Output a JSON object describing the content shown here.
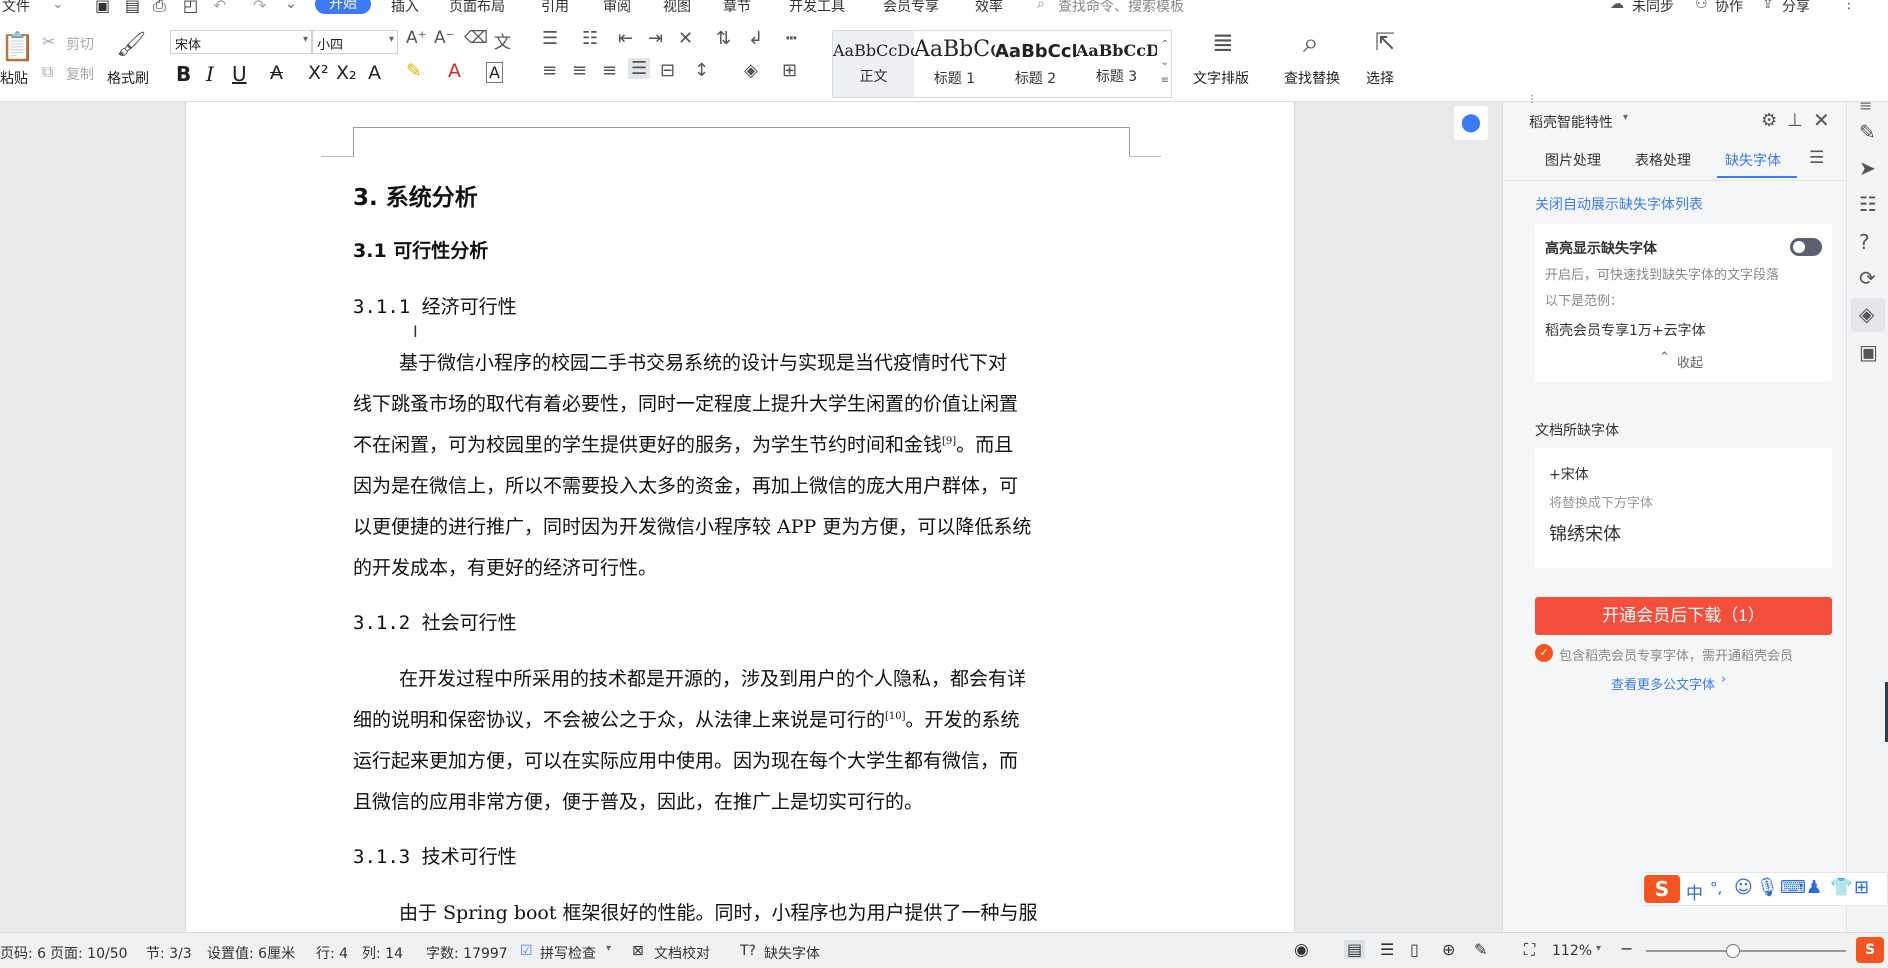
{
  "menu": {
    "file": "文件",
    "home": "开始",
    "insert": "插入",
    "layout": "页面布局",
    "references": "引用",
    "review": "审阅",
    "view": "视图",
    "chapter": "章节",
    "devtools": "开发工具",
    "member": "会员专享",
    "efficiency": "效率",
    "search_placeholder": "查找命令、搜索模板",
    "sync": "未同步",
    "collab": "协作",
    "share": "分享"
  },
  "ribbon": {
    "cut": "剪切",
    "copy": "复制",
    "paste": "粘贴",
    "format_painter": "格式刷",
    "font_name": "宋体",
    "font_size": "小四",
    "styles": [
      {
        "preview": "AaBbCcDd",
        "label": "正文"
      },
      {
        "preview": "AaBbCc",
        "label": "标题 1"
      },
      {
        "preview": "AaBbCcI",
        "label": "标题 2"
      },
      {
        "preview": "AaBbCcDd",
        "label": "标题 3"
      }
    ],
    "text_layout": "文字排版",
    "find_replace": "查找替换",
    "select": "选择"
  },
  "doc": {
    "h_sys": "3. 系统分析",
    "h_feas": "3.1 可行性分析",
    "h_econ": "3.1.1 经济可行性",
    "econ_lines": [
      "基于微信小程序的校园二手书交易系统的设计与实现是当代疫情时代下对",
      "线下跳蚤市场的取代有着必要性，同时一定程度上提升大学生闲置的价值让闲置",
      "不在闲置，可为校园里的学生提供更好的服务，为学生节约时间和金钱",
      "。而且",
      "因为是在微信上，所以不需要投入太多的资金，再加上微信的庞大用户群体，可",
      "以更便捷的进行推广，同时因为开发微信小程序较 APP 更为方便，可以降低系统",
      "的开发成本，有更好的经济可行性。"
    ],
    "cite9": "[9]",
    "h_soc": "3.1.2 社会可行性",
    "soc_lines": [
      "在开发过程中所采用的技术都是开源的，涉及到用户的个人隐私，都会有详",
      "细的说明和保密协议，不会被公之于众，从法律上来说是可行的",
      "。开发的系统",
      "运行起来更加方便，可以在实际应用中使用。因为现在每个大学生都有微信，而",
      "且微信的应用非常方便，便于普及，因此，在推广上是切实可行的。"
    ],
    "cite10": "[10]",
    "h_tech": "3.1.3 技术可行性",
    "tech_line": "由于 Spring boot 框架很好的性能。同时，小程序也为用户提供了一种与服"
  },
  "panel": {
    "title": "稻壳智能特性",
    "tabs": [
      "图片处理",
      "表格处理",
      "缺失字体"
    ],
    "close_auto": "关闭自动展示缺失字体列表",
    "highlight_title": "高亮显示缺失字体",
    "highlight_desc": "开启后，可快速找到缺失字体的文字段落",
    "example_label": "以下是范例：",
    "example_text": "稻壳会员专享1万+云字体",
    "collapse": "收起",
    "missing_title": "文档所缺字体",
    "missing_font": "+宋体",
    "replace_hint": "将替换成下方字体",
    "replace_font": "锦绣宋体",
    "download": "开通会员后下载（1）",
    "vip_note": "包含稻壳会员专享字体，需开通稻壳会员",
    "more_fonts": "查看更多公文字体"
  },
  "status": {
    "page_code": "页码: 6",
    "page": "页面: 10/50",
    "section": "节: 3/3",
    "setting": "设置值: 6厘米",
    "row": "行: 4",
    "col": "列: 14",
    "words": "字数: 17997",
    "spell": "拼写检查",
    "proof": "文档校对",
    "missing": "缺失字体",
    "zoom": "112%"
  },
  "colors": {
    "accent": "#3c7bf5",
    "download": "#f44e3c"
  }
}
